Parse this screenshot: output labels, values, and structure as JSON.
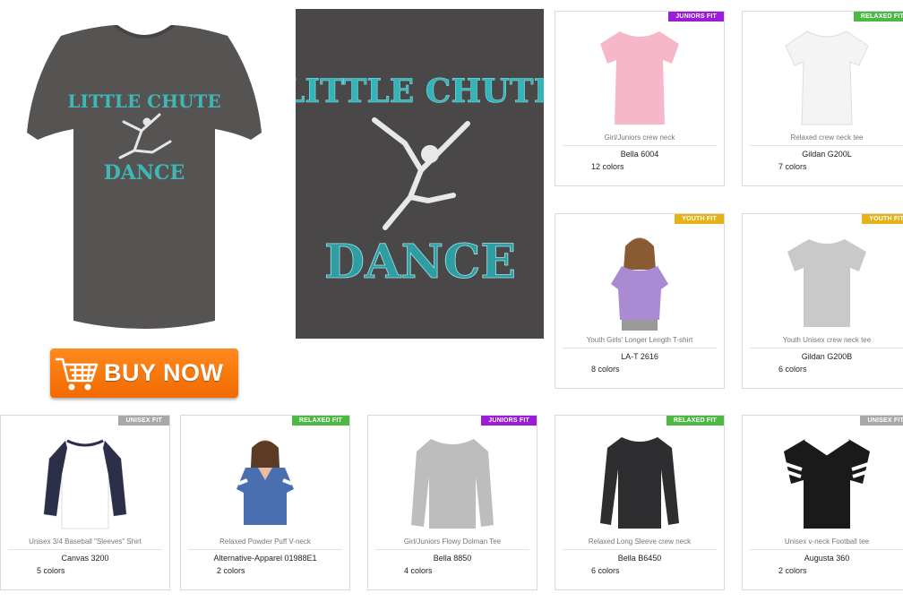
{
  "hero": {
    "print_line1": "LITTLE CHUTE",
    "print_line2": "DANCE",
    "buy_now_label": "BUY NOW"
  },
  "products": [
    {
      "badge": "JUNIORS FIT",
      "badge_color": "#9b1bd6",
      "description": "Girl/Juniors crew neck",
      "model": "Bella 6004",
      "colors": "12 colors",
      "shirt_color": "#f6b8c8",
      "style": "crew"
    },
    {
      "badge": "RELAXED FIT",
      "badge_color": "#4cb944",
      "description": "Relaxed crew neck tee",
      "model": "Gildan G200L",
      "colors": "7 colors",
      "shirt_color": "#f4f4f4",
      "style": "crew"
    },
    {
      "badge": "YOUTH FIT",
      "badge_color": "#e5b318",
      "description": "Youth Girls' Longer Length T-shirt",
      "model": "LA-T 2616",
      "colors": "8 colors",
      "shirt_color": "#a98ad3",
      "style": "girl"
    },
    {
      "badge": "YOUTH FIT",
      "badge_color": "#e5b318",
      "description": "Youth Unisex crew neck tee",
      "model": "Gildan G200B",
      "colors": "6 colors",
      "shirt_color": "#c9c9c9",
      "style": "crew"
    },
    {
      "badge": "UNISEX FIT",
      "badge_color": "#a8a8a8",
      "description": "Unisex 3/4 Baseball \"Sleeves\" Shirt",
      "model": "Canvas 3200",
      "colors": "5 colors",
      "shirt_color": "#ffffff",
      "style": "raglan"
    },
    {
      "badge": "RELAXED FIT",
      "badge_color": "#4cb944",
      "description": "Relaxed Powder Puff V-neck",
      "model": "Alternative-Apparel 01988E1",
      "colors": "2 colors",
      "shirt_color": "#4a6fb0",
      "style": "woman"
    },
    {
      "badge": "JUNIORS FIT",
      "badge_color": "#9b1bd6",
      "description": "Girl/Juniors Flowy Dolman Tee",
      "model": "Bella 8850",
      "colors": "4 colors",
      "shirt_color": "#bdbdbd",
      "style": "longsleeve"
    },
    {
      "badge": "RELAXED FIT",
      "badge_color": "#4cb944",
      "description": "Relaxed Long Sleeve crew neck",
      "model": "Bella B6450",
      "colors": "6 colors",
      "shirt_color": "#2e2e30",
      "style": "longsleeve"
    },
    {
      "badge": "UNISEX FIT",
      "badge_color": "#a8a8a8",
      "description": "Unisex v-neck Football tee",
      "model": "Augusta 360",
      "colors": "2 colors",
      "shirt_color": "#1a1a1a",
      "style": "football"
    }
  ]
}
